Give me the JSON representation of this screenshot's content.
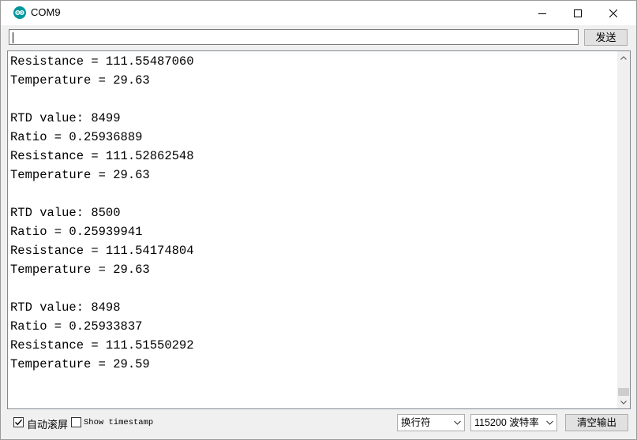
{
  "window": {
    "title": "COM9",
    "icon": "arduino-icon"
  },
  "send_bar": {
    "input_value": "",
    "send_label": "发送"
  },
  "console_lines": [
    "Resistance = 111.55487060",
    "Temperature = 29.63",
    "",
    "RTD value: 8499",
    "Ratio = 0.25936889",
    "Resistance = 111.52862548",
    "Temperature = 29.63",
    "",
    "RTD value: 8500",
    "Ratio = 0.25939941",
    "Resistance = 111.54174804",
    "Temperature = 29.63",
    "",
    "RTD value: 8498",
    "Ratio = 0.25933837",
    "Resistance = 111.51550292",
    "Temperature = 29.59"
  ],
  "bottom_bar": {
    "autoscroll_label": "自动滚屏",
    "autoscroll_checked": true,
    "timestamp_label": "Show timestamp",
    "timestamp_checked": false,
    "line_ending": "换行符",
    "baud_rate": "115200 波特率",
    "clear_label": "清空输出"
  },
  "colors": {
    "arduino_teal": "#00979c",
    "console_bg": "#ffffff",
    "chrome_bg": "#f0f0f0"
  }
}
